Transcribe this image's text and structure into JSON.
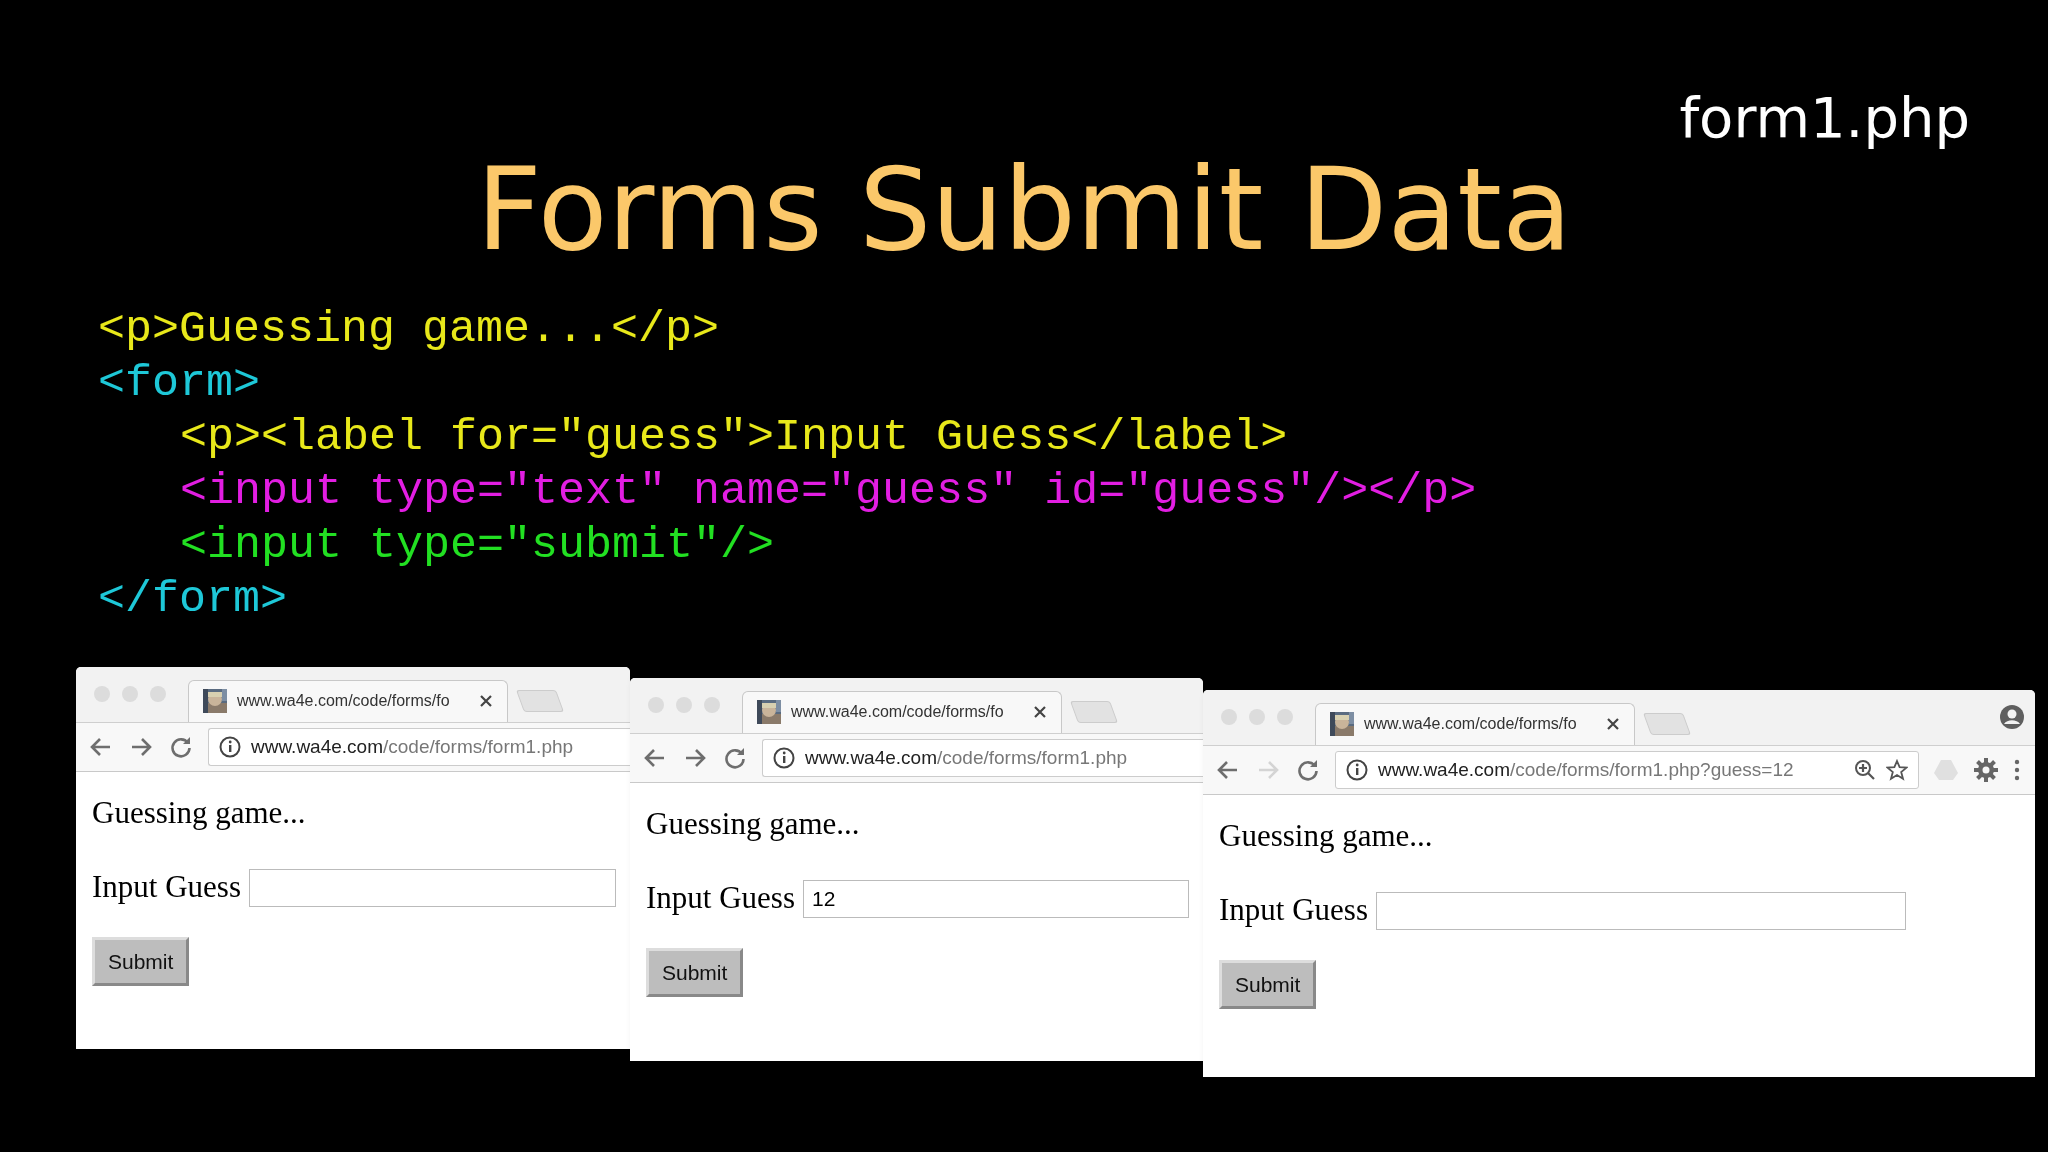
{
  "slide": {
    "filename": "form1.php",
    "title": "Forms Submit Data"
  },
  "code_lines": [
    {
      "text": "<p>Guessing game...</p>",
      "color": "#e8e81a"
    },
    {
      "text": "<form>",
      "color": "#1ec8d8",
      "children": [
        {
          "text": "<p><label for=\"guess\">Input Guess</label>",
          "color": "#e8e81a"
        },
        {
          "text": "<input type=\"text\" name=\"guess\" id=\"guess\"/></p>",
          "color": "#e21ee2"
        },
        {
          "text": "<input type=\"submit\"/>",
          "color": "#22e022"
        }
      ]
    },
    {
      "text": "</form>",
      "color": "#1ec8d8"
    }
  ],
  "browser_windows": [
    {
      "tab_title": "www.wa4e.com/code/forms/fo",
      "url_host": "www.wa4e.com",
      "url_path": "/code/forms/form1.php",
      "forward_disabled": false,
      "full_toolbar": false,
      "heading": "Guessing game...",
      "label": "Input Guess",
      "button": "Submit"
    },
    {
      "tab_title": "www.wa4e.com/code/forms/fo",
      "url_host": "www.wa4e.com",
      "url_path": "/code/forms/form1.php",
      "forward_disabled": false,
      "full_toolbar": false,
      "heading": "Guessing game...",
      "label": "Input Guess",
      "input_value": "12",
      "button": "Submit"
    },
    {
      "tab_title": "www.wa4e.com/code/forms/fo",
      "url_host": "www.wa4e.com",
      "url_path": "/code/forms/form1.php?guess=12",
      "forward_disabled": true,
      "full_toolbar": true,
      "heading": "Guessing game...",
      "label": "Input Guess",
      "button": "Submit"
    }
  ]
}
